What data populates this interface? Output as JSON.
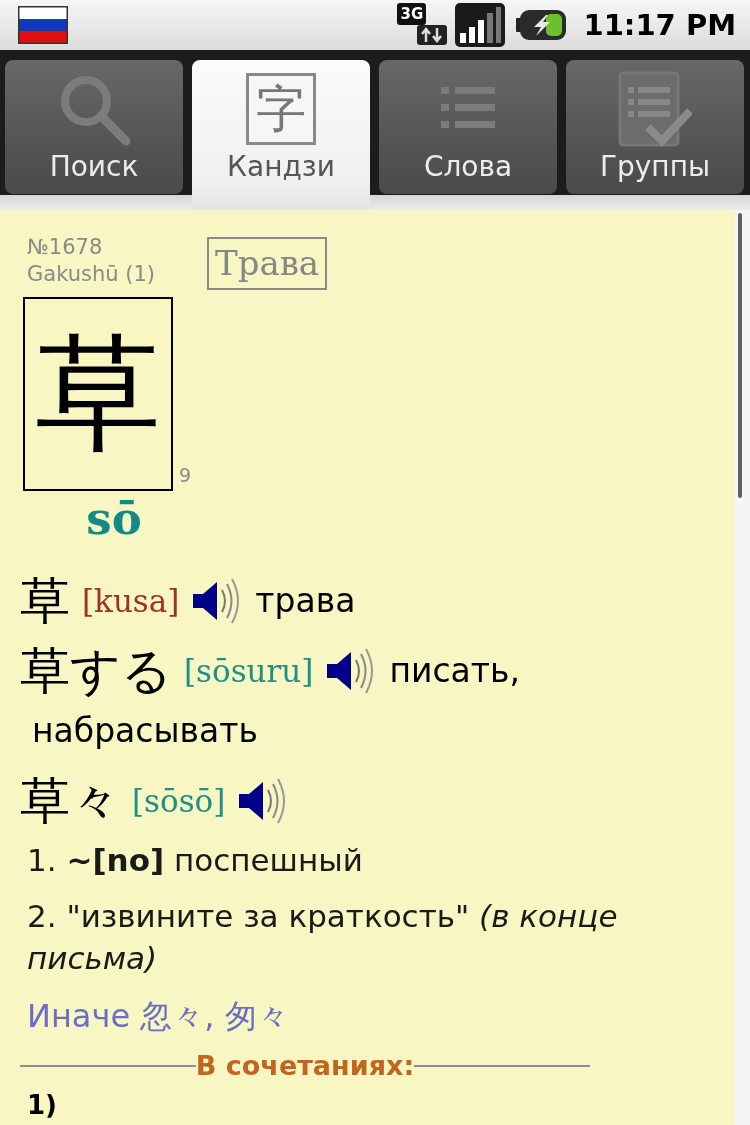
{
  "status_bar": {
    "network": "3G",
    "time": "11:17 PM"
  },
  "tabs": [
    {
      "label": "Поиск",
      "kind": "search",
      "selected": false
    },
    {
      "label": "Кандзи",
      "kind": "kanji",
      "glyph": "字",
      "selected": true
    },
    {
      "label": "Слова",
      "kind": "list",
      "selected": false
    },
    {
      "label": "Группы",
      "kind": "checklist",
      "selected": false
    }
  ],
  "kanji": {
    "number": "№1678",
    "grade": "Gakushū (1)",
    "meaning": "Трава",
    "character": "草",
    "strokes": "9",
    "reading": "sō"
  },
  "words": [
    {
      "word": "草",
      "reading": "[kusa]",
      "color": "#a0302a",
      "translation_lines": [
        "трава"
      ]
    },
    {
      "word": "草する",
      "reading": "[sōsuru]",
      "color": "#1f8f8a",
      "translation_lines": [
        "писать,",
        "набрасывать"
      ]
    },
    {
      "word": "草々",
      "reading": "[sōsō]",
      "color": "#1f8f8a",
      "senses": [
        "1. **~[no]** поспешный",
        "2. \"извините за краткость\" *(в конце письма)*"
      ],
      "variants": "Иначе 忽々, 匆々"
    }
  ],
  "combinations": {
    "heading": "В сочетаниях:",
    "items": [
      "1)"
    ]
  }
}
